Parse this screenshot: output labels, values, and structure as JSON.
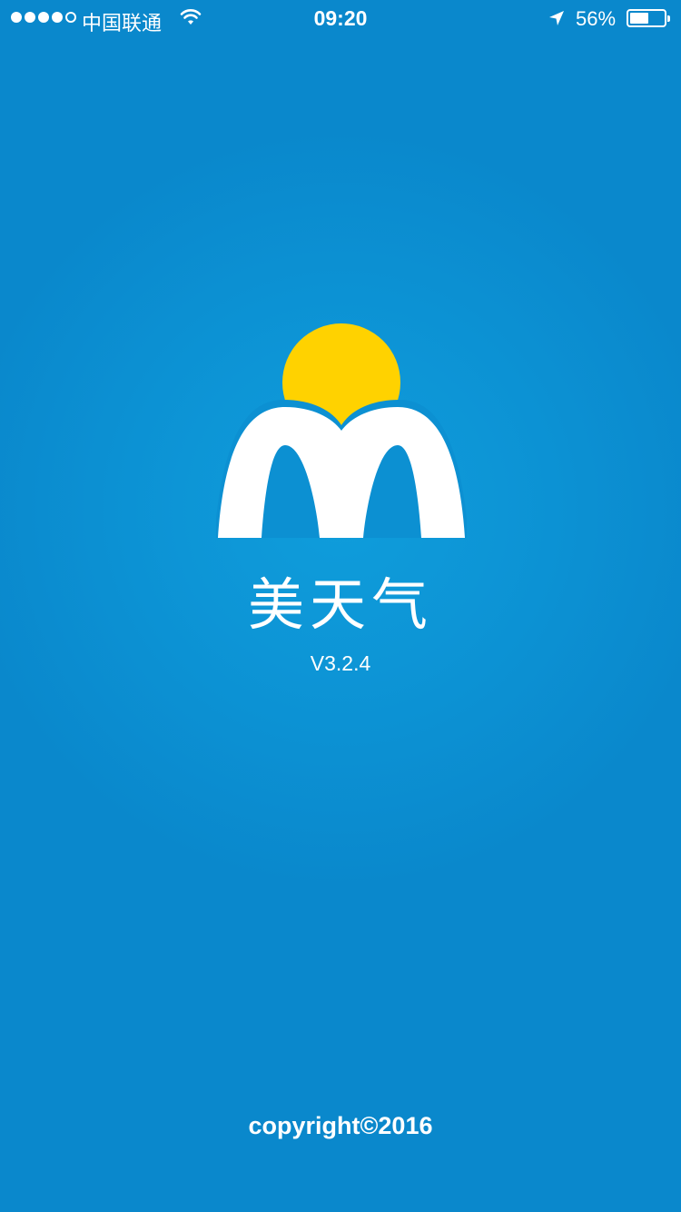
{
  "status_bar": {
    "carrier": "中国联通",
    "time": "09:20",
    "battery_percent_label": "56%",
    "battery_level": 0.56,
    "signal_bars_filled": 4,
    "signal_bars_total": 5
  },
  "splash": {
    "app_name": "美天气",
    "version": "V3.2.4",
    "copyright": "copyright©2016"
  },
  "colors": {
    "background": "#0a88cc",
    "sun": "#ffd200",
    "text": "#ffffff"
  }
}
